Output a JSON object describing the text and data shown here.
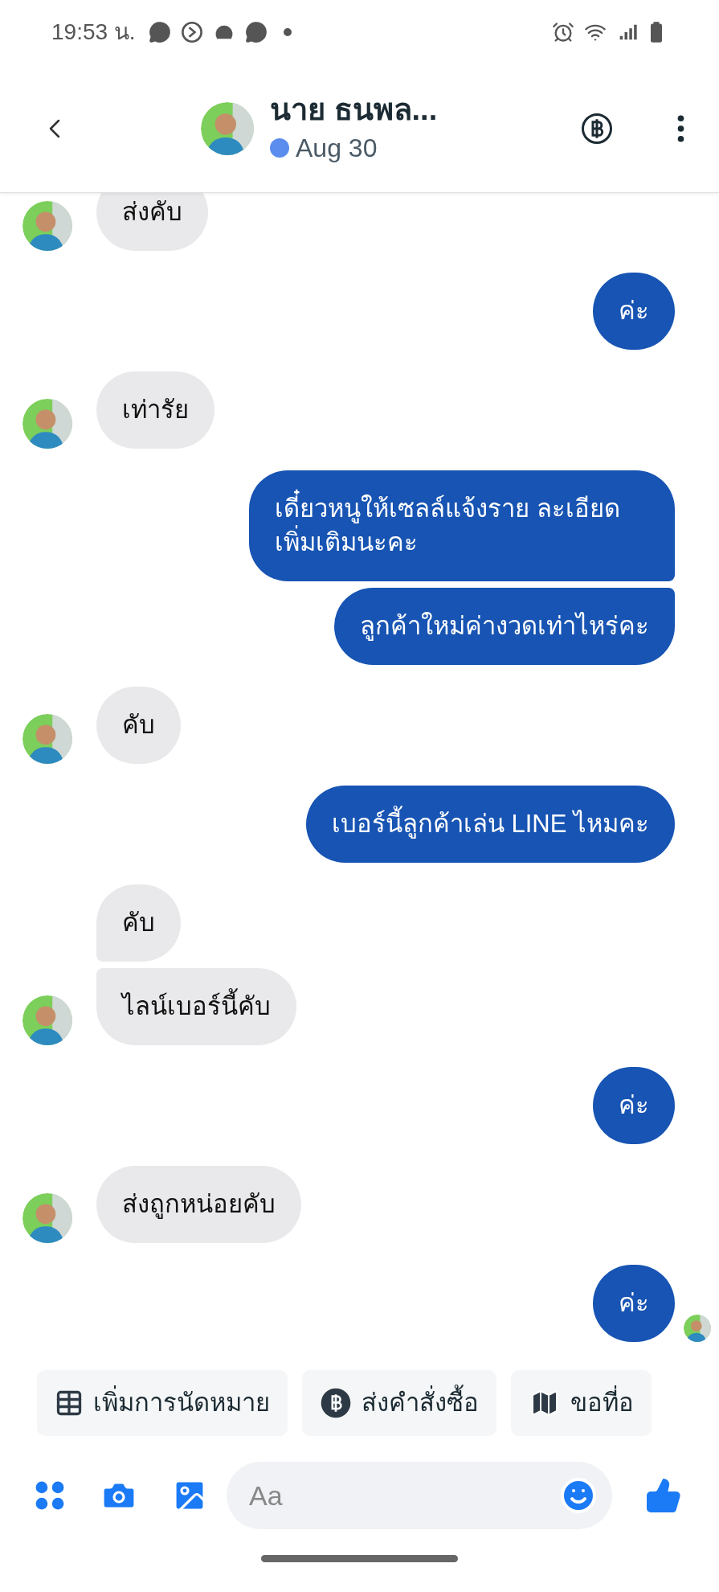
{
  "status_bar": {
    "time": "19:53 น."
  },
  "header": {
    "title": "นาย ธนพล...",
    "status": "Aug 30",
    "online": true
  },
  "messages": [
    {
      "kind": "incoming",
      "text": "ส่งคับ",
      "avatar": true
    },
    {
      "kind": "outgoing",
      "text": "ค่ะ",
      "avatar": false
    },
    {
      "kind": "incoming",
      "text": "เท่ารัย",
      "avatar": true
    },
    {
      "kind": "outgoing",
      "text": "เดี๋ยวหนูให้เซลล์แจ้งราย ละเอียดเพิ่มเติมนะคะ",
      "avatar": false
    },
    {
      "kind": "outgoing",
      "text": "ลูกค้าใหม่ค่างวดเท่าไหร่คะ",
      "avatar": false
    },
    {
      "kind": "incoming",
      "text": "คับ",
      "avatar": true
    },
    {
      "kind": "outgoing",
      "text": "เบอร์นี้ลูกค้าเล่น LINE ไหมคะ",
      "avatar": false
    },
    {
      "kind": "incoming",
      "text": "คับ",
      "avatar": false
    },
    {
      "kind": "incoming",
      "text": "ไลน์เบอร์นี้คับ",
      "avatar": true
    },
    {
      "kind": "outgoing",
      "text": "ค่ะ",
      "avatar": false
    },
    {
      "kind": "incoming",
      "text": "ส่งถูกหน่อยคับ",
      "avatar": true
    },
    {
      "kind": "outgoing",
      "text": "ค่ะ",
      "avatar": true
    }
  ],
  "quick_replies": [
    {
      "kind": "calendar",
      "label": "เพิ่มการนัดหมาย"
    },
    {
      "kind": "baht",
      "label": "ส่งคำสั่งซื้อ"
    },
    {
      "kind": "map",
      "label": "ขอที่อ"
    }
  ],
  "composer": {
    "placeholder": "Aa"
  }
}
